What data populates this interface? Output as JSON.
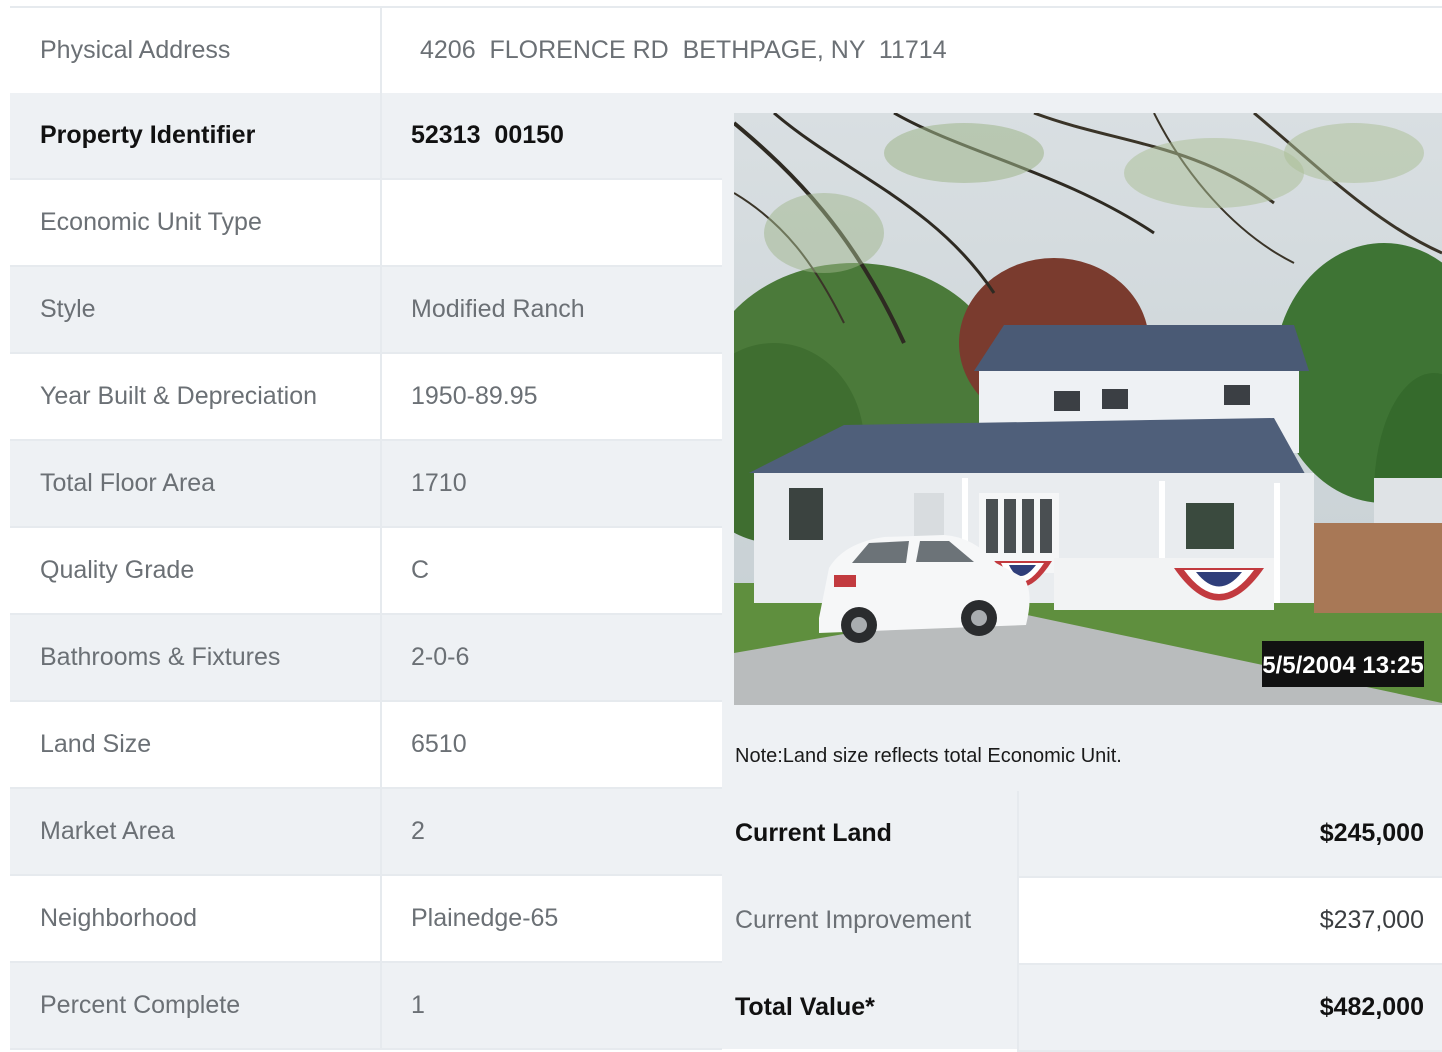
{
  "address": {
    "label": "Physical Address",
    "value": "4206  FLORENCE RD  BETHPAGE, NY  11714"
  },
  "details": [
    {
      "label": "Property Identifier",
      "value": "52313  00150",
      "bold": true
    },
    {
      "label": "Economic Unit Type",
      "value": ""
    },
    {
      "label": "Style",
      "value": "Modified Ranch"
    },
    {
      "label": "Year Built & Depreciation",
      "value": "1950-89.95"
    },
    {
      "label": "Total Floor Area",
      "value": "1710"
    },
    {
      "label": "Quality Grade",
      "value": "C"
    },
    {
      "label": "Bathrooms & Fixtures",
      "value": "2-0-6"
    },
    {
      "label": "Land Size",
      "value": "6510"
    },
    {
      "label": "Market Area",
      "value": "2"
    },
    {
      "label": "Neighborhood",
      "value": "Plainedge-65"
    },
    {
      "label": "Percent Complete",
      "value": "1"
    }
  ],
  "photo": {
    "timestamp": "5/5/2004 13:25"
  },
  "note": "Note:Land size reflects total Economic Unit.",
  "valuation": [
    {
      "label": "Current Land",
      "value": "$245,000",
      "bold": true
    },
    {
      "label": "Current Improvement",
      "value": "$237,000"
    },
    {
      "label": "Total Value*",
      "value": "$482,000",
      "bold": true
    }
  ],
  "colors": {
    "row_shade": "#eef1f4",
    "border": "#e6eaee",
    "text_muted": "#6b7075",
    "text_strong": "#111111"
  }
}
